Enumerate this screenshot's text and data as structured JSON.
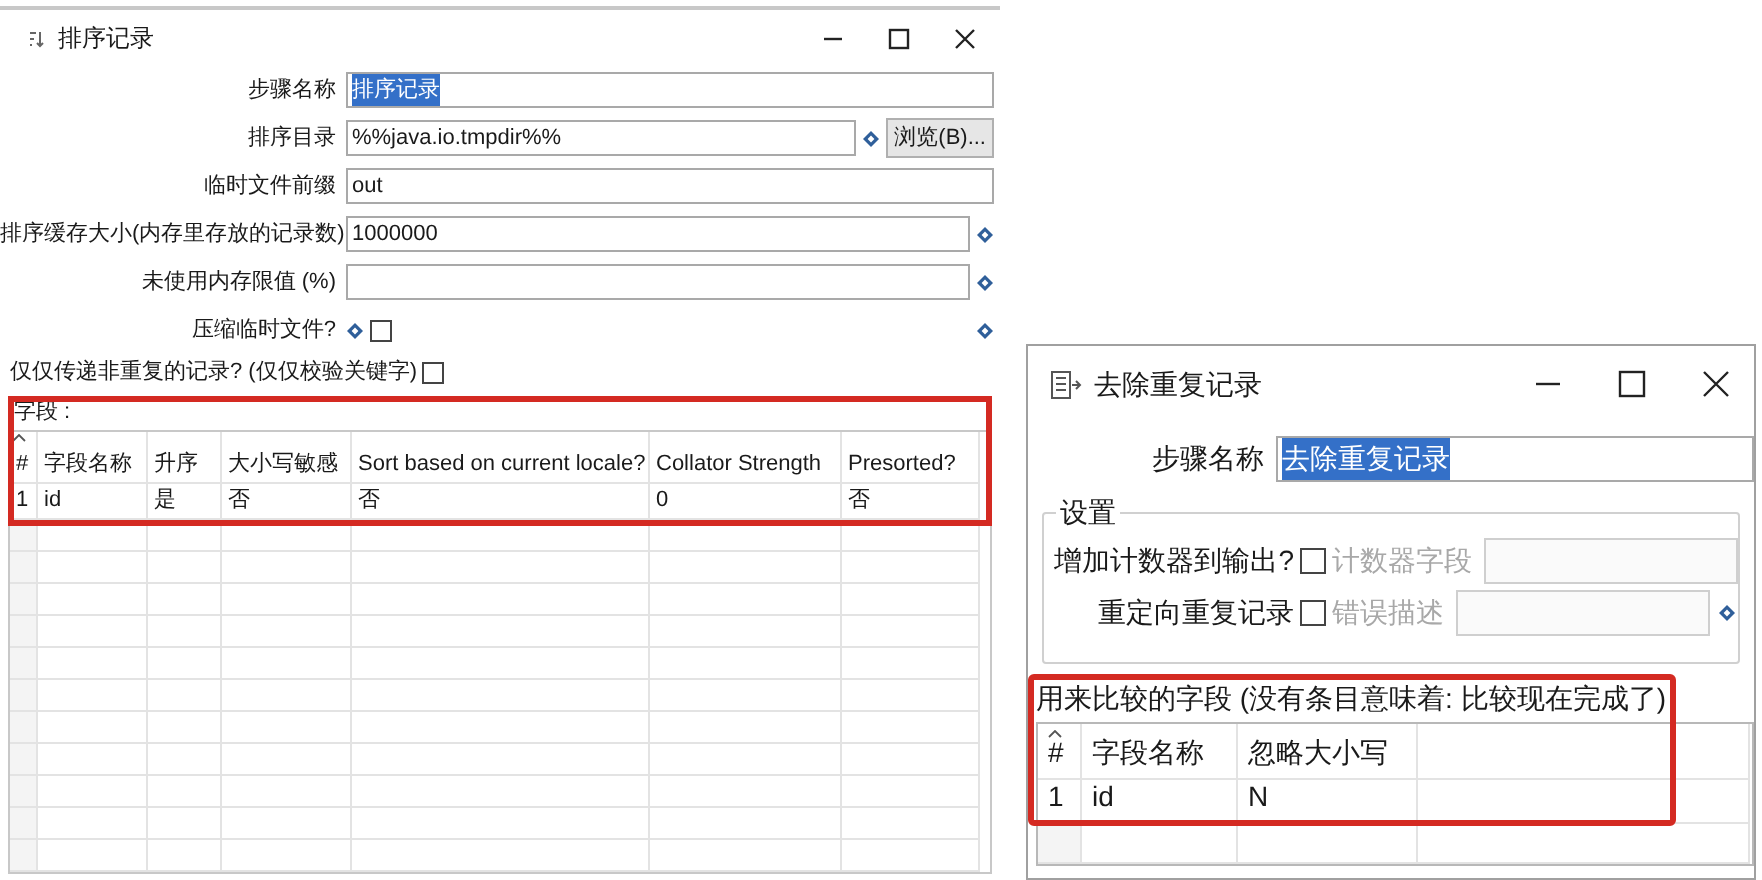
{
  "sort_dialog": {
    "title": "排序记录",
    "fields": [
      {
        "kind": "text",
        "label": "步骤名称",
        "value": "排序记录",
        "selected": true
      },
      {
        "kind": "path",
        "label": "排序目录",
        "value": "%%java.io.tmpdir%%",
        "selected": false,
        "button": "浏览(B)..."
      },
      {
        "kind": "text",
        "label": "临时文件前缀",
        "value": "out",
        "selected": false
      },
      {
        "kind": "variable",
        "label": "排序缓存大小(内存里存放的记录数)",
        "value": "1000000",
        "selected": false
      },
      {
        "kind": "variable",
        "label": "未使用内存限值 (%)"
      },
      {
        "kind": "checkbox",
        "label": "压缩临时文件?",
        "checked": false
      },
      {
        "kind": "wide_checkbox",
        "label": "仅仅传递非重复的记录? (仅仅校验关键字)",
        "checked": false
      }
    ],
    "table": {
      "title": "字段 :",
      "highlighted": true,
      "columns": [
        "#",
        "字段名称",
        "升序",
        "大小写敏感",
        "Sort based on current locale?",
        "Collator Strength",
        "Presorted?"
      ],
      "rows": [
        [
          "1",
          "id",
          "是",
          "否",
          "否",
          "0",
          "否"
        ]
      ]
    }
  },
  "dedupe_dialog": {
    "title": "去除重复记录",
    "step_name": {
      "label": "步骤名称",
      "value": "去除重复记录",
      "selected": true
    },
    "settings": {
      "legend": "设置",
      "options": [
        {
          "kind": "plain",
          "label": "增加计数器到输出?",
          "checked": false,
          "field_label": "计数器字段",
          "disabled": true
        },
        {
          "kind": "variable",
          "label": "重定向重复记录",
          "checked": false,
          "field_label": "错误描述",
          "disabled": true
        }
      ]
    },
    "table": {
      "title": "用来比较的字段 (没有条目意味着: 比较现在完成了)",
      "highlighted": true,
      "columns": [
        "#",
        "字段名称",
        "忽略大小写"
      ],
      "rows": [
        [
          "1",
          "id",
          "N"
        ]
      ]
    }
  }
}
